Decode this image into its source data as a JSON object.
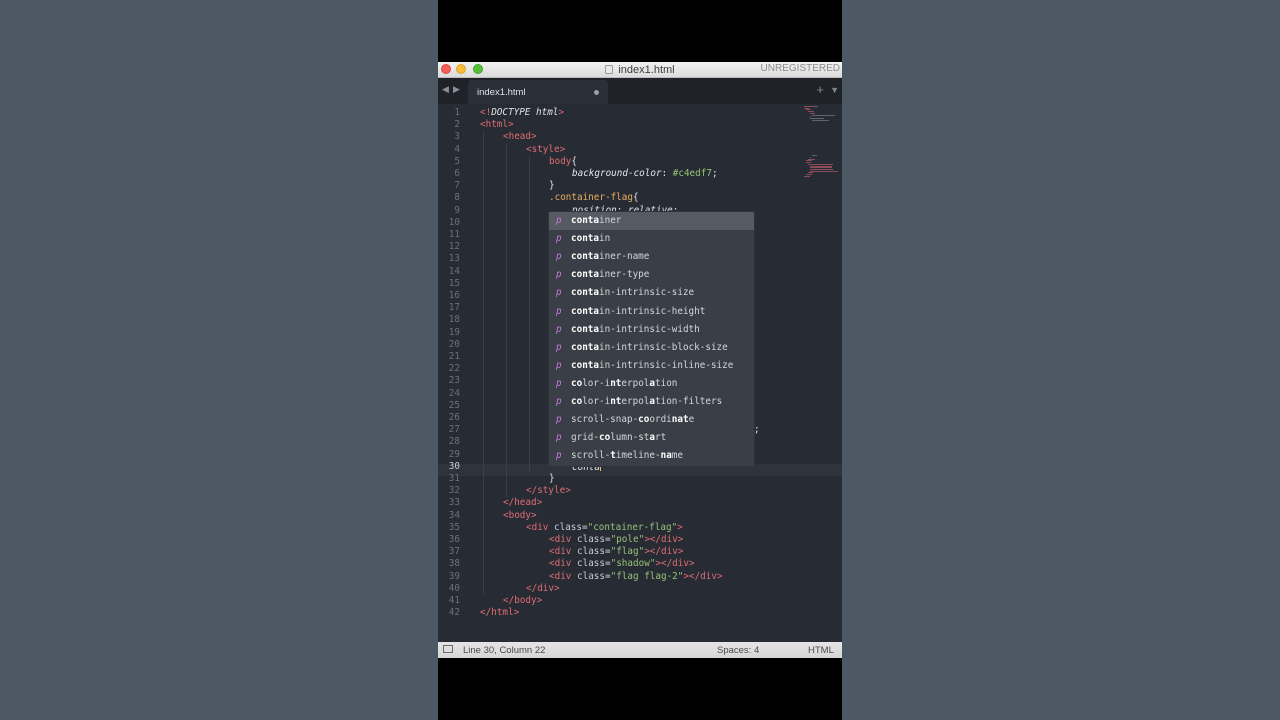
{
  "window": {
    "title": "index1.html",
    "license": "UNREGISTERED"
  },
  "tabs": [
    {
      "label": "index1.html",
      "modified": true
    }
  ],
  "editor": {
    "active_line": 30,
    "lines": [
      {
        "n": "1",
        "indent": 0,
        "tokens": [
          [
            "t",
            "<!"
          ],
          [
            "k",
            "DOCTYPE"
          ],
          [
            "p",
            " "
          ],
          [
            "i",
            "html"
          ],
          [
            "t",
            ">"
          ]
        ]
      },
      {
        "n": "2",
        "indent": 0,
        "tokens": [
          [
            "t",
            "<"
          ],
          [
            "t",
            "html"
          ],
          [
            "t",
            ">"
          ]
        ]
      },
      {
        "n": "3",
        "indent": 1,
        "tokens": [
          [
            "t",
            "<"
          ],
          [
            "t",
            "head"
          ],
          [
            "t",
            ">"
          ]
        ]
      },
      {
        "n": "4",
        "indent": 2,
        "tokens": [
          [
            "t",
            "<"
          ],
          [
            "t",
            "style"
          ],
          [
            "t",
            ">"
          ]
        ]
      },
      {
        "n": "5",
        "indent": 3,
        "tokens": [
          [
            "t",
            "body"
          ],
          [
            "p",
            "{"
          ]
        ]
      },
      {
        "n": "6",
        "indent": 4,
        "tokens": [
          [
            "i",
            "background-color"
          ],
          [
            "p",
            ": "
          ],
          [
            "h",
            "#c4edf7"
          ],
          [
            "p",
            ";"
          ]
        ]
      },
      {
        "n": "7",
        "indent": 3,
        "tokens": [
          [
            "p",
            "}"
          ]
        ]
      },
      {
        "n": "8",
        "indent": 3,
        "tokens": [
          [
            "sel",
            ".container-flag"
          ],
          [
            "p",
            "{"
          ]
        ]
      },
      {
        "n": "9",
        "indent": 4,
        "tokens": [
          [
            "i",
            "position"
          ],
          [
            "p",
            ": "
          ],
          [
            "i",
            "relative"
          ],
          [
            "p",
            ";"
          ]
        ]
      },
      {
        "n": "10",
        "indent": 0,
        "tokens": []
      },
      {
        "n": "11",
        "indent": 0,
        "tokens": []
      },
      {
        "n": "12",
        "indent": 0,
        "tokens": []
      },
      {
        "n": "13",
        "indent": 0,
        "tokens": []
      },
      {
        "n": "14",
        "indent": 0,
        "tokens": []
      },
      {
        "n": "15",
        "indent": 0,
        "tokens": []
      },
      {
        "n": "16",
        "indent": 0,
        "tokens": []
      },
      {
        "n": "17",
        "indent": 0,
        "tokens": []
      },
      {
        "n": "18",
        "indent": 0,
        "tokens": []
      },
      {
        "n": "19",
        "indent": 0,
        "tokens": []
      },
      {
        "n": "20",
        "indent": 0,
        "tokens": []
      },
      {
        "n": "21",
        "indent": 0,
        "tokens": []
      },
      {
        "n": "22",
        "indent": 0,
        "tokens": []
      },
      {
        "n": "23",
        "indent": 0,
        "tokens": []
      },
      {
        "n": "24",
        "indent": 0,
        "tokens": []
      },
      {
        "n": "25",
        "indent": 0,
        "tokens": []
      },
      {
        "n": "26",
        "indent": 0,
        "tokens": []
      },
      {
        "n": "27",
        "indent": 0,
        "tokens": []
      },
      {
        "n": "28",
        "indent": 0,
        "tokens": []
      },
      {
        "n": "29",
        "indent": 0,
        "tokens": []
      },
      {
        "n": "30",
        "indent": 4,
        "tokens": [
          [
            "cur",
            "conta"
          ]
        ],
        "caret": true
      },
      {
        "n": "31",
        "indent": 3,
        "tokens": [
          [
            "p",
            "}"
          ]
        ]
      },
      {
        "n": "32",
        "indent": 2,
        "tokens": [
          [
            "t",
            "</"
          ],
          [
            "t",
            "style"
          ],
          [
            "t",
            ">"
          ]
        ]
      },
      {
        "n": "33",
        "indent": 1,
        "tokens": [
          [
            "t",
            "</"
          ],
          [
            "t",
            "head"
          ],
          [
            "t",
            ">"
          ]
        ]
      },
      {
        "n": "34",
        "indent": 1,
        "tokens": [
          [
            "t",
            "<"
          ],
          [
            "t",
            "body"
          ],
          [
            "t",
            ">"
          ]
        ]
      },
      {
        "n": "35",
        "indent": 2,
        "tokens": [
          [
            "t",
            "<div "
          ],
          [
            "a",
            "class"
          ],
          [
            "p",
            "="
          ],
          [
            "s",
            "\"container-flag\""
          ],
          [
            "t",
            ">"
          ]
        ]
      },
      {
        "n": "36",
        "indent": 3,
        "tokens": [
          [
            "t",
            "<div "
          ],
          [
            "a",
            "class"
          ],
          [
            "p",
            "="
          ],
          [
            "s",
            "\"pole\""
          ],
          [
            "t",
            "></div>"
          ]
        ]
      },
      {
        "n": "37",
        "indent": 3,
        "tokens": [
          [
            "t",
            "<div "
          ],
          [
            "a",
            "class"
          ],
          [
            "p",
            "="
          ],
          [
            "s",
            "\"flag\""
          ],
          [
            "t",
            "></div>"
          ]
        ]
      },
      {
        "n": "38",
        "indent": 3,
        "tokens": [
          [
            "t",
            "<div "
          ],
          [
            "a",
            "class"
          ],
          [
            "p",
            "="
          ],
          [
            "s",
            "\"shadow\""
          ],
          [
            "t",
            "></div>"
          ]
        ]
      },
      {
        "n": "39",
        "indent": 3,
        "tokens": [
          [
            "t",
            "<div "
          ],
          [
            "a",
            "class"
          ],
          [
            "p",
            "="
          ],
          [
            "s",
            "\"flag flag-2\""
          ],
          [
            "t",
            "></div>"
          ]
        ]
      },
      {
        "n": "40",
        "indent": 2,
        "tokens": [
          [
            "t",
            "</div>"
          ]
        ]
      },
      {
        "n": "41",
        "indent": 1,
        "tokens": [
          [
            "t",
            "</body>"
          ]
        ]
      },
      {
        "n": "42",
        "indent": 0,
        "tokens": [
          [
            "t",
            "</html>"
          ]
        ]
      }
    ],
    "partial_line_27_suffix": ";"
  },
  "autocomplete": {
    "selected_index": 0,
    "items": [
      {
        "kind": "p",
        "match": "conta",
        "rest": "iner"
      },
      {
        "kind": "p",
        "match": "conta",
        "rest": "in"
      },
      {
        "kind": "p",
        "match": "conta",
        "rest": "iner-name"
      },
      {
        "kind": "p",
        "match": "conta",
        "rest": "iner-type"
      },
      {
        "kind": "p",
        "match": "conta",
        "rest": "in-intrinsic-size"
      },
      {
        "kind": "p",
        "match": "conta",
        "rest": "in-intrinsic-height"
      },
      {
        "kind": "p",
        "match": "conta",
        "rest": "in-intrinsic-width"
      },
      {
        "kind": "p",
        "match": "conta",
        "rest": "in-intrinsic-block-size"
      },
      {
        "kind": "p",
        "match": "conta",
        "rest": "in-intrinsic-inline-size"
      },
      {
        "kind": "p",
        "segments": [
          [
            "co",
            true
          ],
          [
            "lor-i",
            false
          ],
          [
            "nt",
            true
          ],
          [
            "erpol",
            false
          ],
          [
            "a",
            true
          ],
          [
            "tion",
            false
          ]
        ]
      },
      {
        "kind": "p",
        "segments": [
          [
            "co",
            true
          ],
          [
            "lor-i",
            false
          ],
          [
            "nt",
            true
          ],
          [
            "erpol",
            false
          ],
          [
            "a",
            true
          ],
          [
            "tion-filters",
            false
          ]
        ]
      },
      {
        "kind": "p",
        "segments": [
          [
            "scroll-snap-",
            false
          ],
          [
            "co",
            true
          ],
          [
            "ordi",
            false
          ],
          [
            "nat",
            true
          ],
          [
            "e",
            false
          ]
        ]
      },
      {
        "kind": "p",
        "segments": [
          [
            "grid-",
            false
          ],
          [
            "co",
            true
          ],
          [
            "lumn-st",
            false
          ],
          [
            "a",
            true
          ],
          [
            "rt",
            false
          ]
        ]
      },
      {
        "kind": "p",
        "segments": [
          [
            "sc",
            false
          ],
          [
            "ro",
            false
          ],
          [
            "ll-",
            false
          ],
          [
            "t",
            true
          ],
          [
            "imeline-",
            false
          ],
          [
            "na",
            true
          ],
          [
            "me",
            false
          ]
        ]
      }
    ]
  },
  "statusbar": {
    "position": "Line 30, Column 22",
    "spaces": "Spaces: 4",
    "syntax": "HTML"
  },
  "colors": {
    "background": "#4c5964",
    "editor_bg": "#272b33",
    "tag": "#e06c75",
    "string": "#98c379",
    "selector": "#e9ad5f",
    "popup_bg": "#3a3f47",
    "popup_selected": "#555a63",
    "kind_badge": "#c678dd"
  },
  "icons": {
    "close": "red-traffic-light",
    "minimize": "yellow-traffic-light",
    "maximize": "green-traffic-light",
    "nav_back": "triangle-left",
    "nav_forward": "triangle-right",
    "new_tab": "plus",
    "tab_menu": "triangle-down",
    "panel_toggle": "panel-square"
  }
}
